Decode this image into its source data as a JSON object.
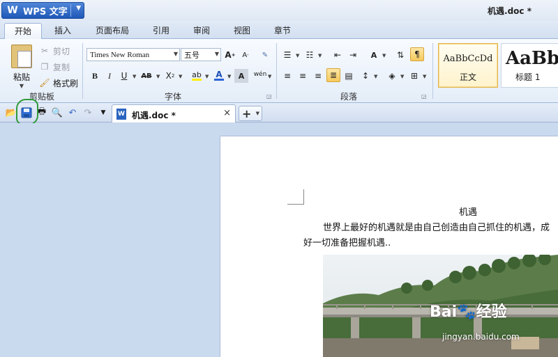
{
  "app": {
    "name": "WPS 文字",
    "document_title": "机遇.doc *"
  },
  "ribbon_tabs": [
    {
      "label": "开始",
      "active": true
    },
    {
      "label": "插入"
    },
    {
      "label": "页面布局"
    },
    {
      "label": "引用"
    },
    {
      "label": "审阅"
    },
    {
      "label": "视图"
    },
    {
      "label": "章节"
    }
  ],
  "clipboard": {
    "paste_label": "粘贴",
    "cut_label": "剪切",
    "copy_label": "复制",
    "format_painter_label": "格式刷",
    "group_label": "剪贴板"
  },
  "font": {
    "family": "Times New Roman",
    "size": "五号",
    "group_label": "字体",
    "phonetic_label": "wén"
  },
  "paragraph": {
    "group_label": "段落"
  },
  "styles": [
    {
      "sample": "AaBbCcDd",
      "name": "正文",
      "selected": true
    },
    {
      "sample": "AaBb",
      "name": "标题 1"
    }
  ],
  "doc_tab": {
    "icon_letter": "W",
    "title": "机遇.doc *",
    "close": "×"
  },
  "document": {
    "heading": "机遇",
    "line1": "世界上最好的机遇就是由自己创造由自己抓住的机遇，成",
    "line2": "好一切准备把握机遇.."
  },
  "watermark": {
    "brand": "Bai",
    "suffix": "经验",
    "url": "jingyan.baidu.com"
  },
  "colors": {
    "accent": "#1f58b8",
    "highlight_annotation": "#2f9a3a",
    "font_color_bar": "#e0201b",
    "highlight_bar": "#ffee00"
  }
}
